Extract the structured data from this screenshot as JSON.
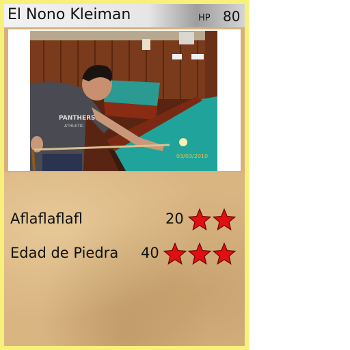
{
  "card": {
    "name": "El Nono Kleiman",
    "hp_label": "HP",
    "hp_value": "80",
    "photo": {
      "date_stamp": "03/03/2010"
    },
    "attacks": [
      {
        "name": "Aflaflaflafl",
        "damage": "20",
        "energy_count": 2,
        "energy_icon": "red-star-icon"
      },
      {
        "name": "Edad de Piedra",
        "damage": "40",
        "energy_count": 3,
        "energy_icon": "red-star-icon"
      }
    ]
  },
  "colors": {
    "border": "#f7f07a",
    "parchment": "#d9b582",
    "star": "#e01010",
    "pool_table_felt": "#1fa39a"
  }
}
